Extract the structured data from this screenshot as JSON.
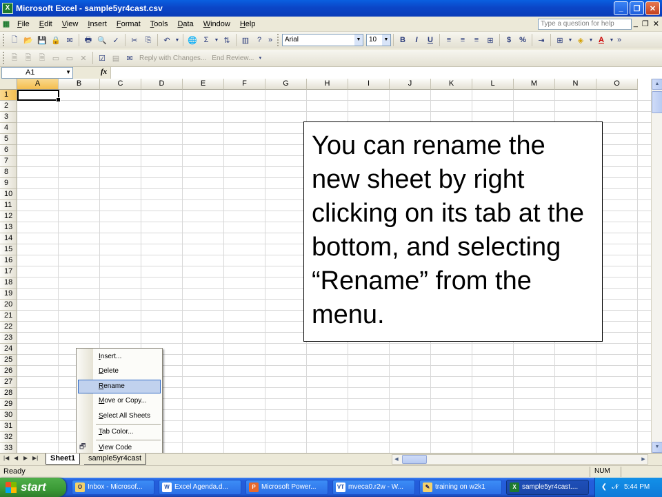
{
  "window": {
    "title": "Microsoft Excel - sample5yr4cast.csv"
  },
  "menubar": {
    "items": [
      "File",
      "Edit",
      "View",
      "Insert",
      "Format",
      "Tools",
      "Data",
      "Window",
      "Help"
    ],
    "ask_placeholder": "Type a question for help"
  },
  "toolbar": {
    "font_name": "Arial",
    "font_size": "10",
    "bold": "B",
    "italic": "I",
    "underline": "U",
    "currency": "$",
    "percent": "%",
    "reply_changes": "Reply with Changes...",
    "end_review": "End Review..."
  },
  "formula_bar": {
    "name_box": "A1",
    "fx": "fx",
    "formula": ""
  },
  "columns": [
    "A",
    "B",
    "C",
    "D",
    "E",
    "F",
    "G",
    "H",
    "I",
    "J",
    "K",
    "L",
    "M",
    "N",
    "O"
  ],
  "rows": [
    "1",
    "2",
    "3",
    "4",
    "5",
    "6",
    "7",
    "8",
    "9",
    "10",
    "11",
    "12",
    "13",
    "14",
    "15",
    "16",
    "17",
    "18",
    "19",
    "20",
    "21",
    "22",
    "23",
    "24",
    "25",
    "26",
    "27",
    "28",
    "29",
    "30",
    "31",
    "32",
    "33"
  ],
  "callout": {
    "text": "You can rename the new sheet by right clicking on its tab at the bottom, and selecting “Rename” from the menu."
  },
  "context_menu": {
    "items": [
      "Insert...",
      "Delete",
      "Rename",
      "Move or Copy...",
      "Select All Sheets",
      "Tab Color...",
      "View Code"
    ],
    "highlighted": "Rename"
  },
  "sheet_tabs": [
    "Sheet1",
    "sample5yr4cast"
  ],
  "status": {
    "ready": "Ready",
    "num": "NUM"
  },
  "taskbar": {
    "start": "start",
    "tasks": [
      "Inbox - Microsof...",
      "Excel Agenda.d...",
      "Microsoft Power...",
      "mveca0.r2w - W...",
      "training on w2k1",
      "sample5yr4cast...."
    ],
    "clock": "5:44 PM"
  }
}
